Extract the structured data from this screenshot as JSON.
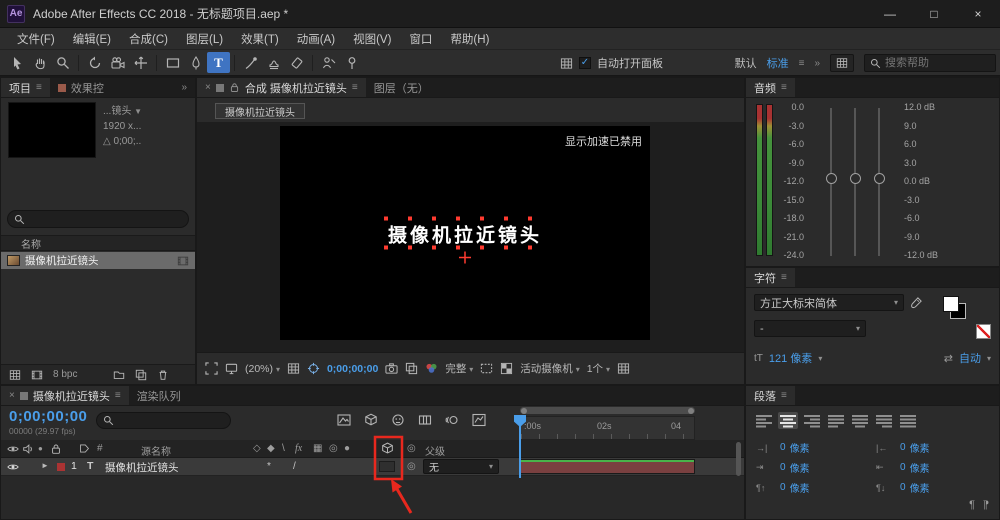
{
  "glyphs": {
    "minimize": "—",
    "maximize": "□",
    "close": "×",
    "caret": "▾",
    "menu": "≡",
    "overflow": "»",
    "expand": "►",
    "hash": "#",
    "asterisk": "*",
    "slash": "/",
    "solo": "●",
    "pickwhip": "◎",
    "pilcrow": "¶",
    "check": "✓",
    "size_icon": "tT",
    "kerning_icon": "⇄",
    "preview_caret": "▼"
  },
  "titlebar": {
    "app_initials": "Ae",
    "title": "Adobe After Effects CC 2018 - 无标题项目.aep *"
  },
  "menubar": {
    "items": [
      "文件(F)",
      "编辑(E)",
      "合成(C)",
      "图层(L)",
      "效果(T)",
      "动画(A)",
      "视图(V)",
      "窗口",
      "帮助(H)"
    ]
  },
  "toolbar": {
    "auto_open_label": "自动打开面板",
    "workspace_default": "默认",
    "workspace_standard": "标准",
    "search_placeholder": "搜索帮助"
  },
  "project_panel": {
    "tab_project": "项目",
    "tab_effect_controls": "效果控",
    "preview_title": "...镜头",
    "preview_dimensions": "1920 x...",
    "preview_meta": "△ 0;00;..",
    "column_name": "名称",
    "item_name": "摄像机拉近镜头",
    "bit_depth": "8 bpc"
  },
  "comp_panel": {
    "tab_label": "合成 摄像机拉近镜头",
    "tab_layer": "图层（无）",
    "flowchart_button": "摄像机拉近镜头",
    "acceleration_notice": "显示加速已禁用",
    "canvas_text": "摄像机拉近镜头",
    "zoom_level": "(20%)",
    "timecode": "0;00;00;00",
    "resolution": "完整",
    "camera_view": "活动摄像机",
    "view_layout": "1个"
  },
  "audio_panel": {
    "title": "音频",
    "left_scale": [
      "0.0",
      "-3.0",
      "-6.0",
      "-9.0",
      "-12.0",
      "-15.0",
      "-18.0",
      "-21.0",
      "-24.0"
    ],
    "right_scale": [
      "12.0 dB",
      "9.0",
      "6.0",
      "3.0",
      "0.0 dB",
      "-3.0",
      "-6.0",
      "-9.0",
      "-12.0 dB"
    ]
  },
  "character_panel": {
    "title": "字符",
    "font_family": "方正大标宋简体",
    "font_style": "-",
    "font_size": "121",
    "size_unit": "像素",
    "kerning": "自动"
  },
  "timeline_panel": {
    "tab_comp": "摄像机拉近镜头",
    "tab_render_queue": "渲染队列",
    "timecode": "0;00;00;00",
    "frame_info": "00000 (29.97 fps)",
    "column_source_name": "源名称",
    "column_parent": "父级",
    "switch_glyphs": [
      "◇",
      "◆",
      "\\",
      "fx",
      "▦",
      "◎",
      "●"
    ],
    "layer": {
      "index": "1",
      "type_glyph": "T",
      "name": "摄像机拉近镜头",
      "parent_value": "无"
    },
    "ruler_labels": [
      ":00s",
      "02s",
      "04"
    ]
  },
  "paragraph_panel": {
    "title": "段落",
    "field_icons": [
      "→|",
      "|←",
      "⇥",
      "⇤",
      "¶↑",
      "¶↓"
    ],
    "fields": [
      {
        "value": "0",
        "unit": "像素"
      },
      {
        "value": "0",
        "unit": "像素"
      },
      {
        "value": "0",
        "unit": "像素"
      },
      {
        "value": "0",
        "unit": "像素"
      },
      {
        "value": "0",
        "unit": "像素"
      },
      {
        "value": "0",
        "unit": "像素"
      }
    ]
  }
}
